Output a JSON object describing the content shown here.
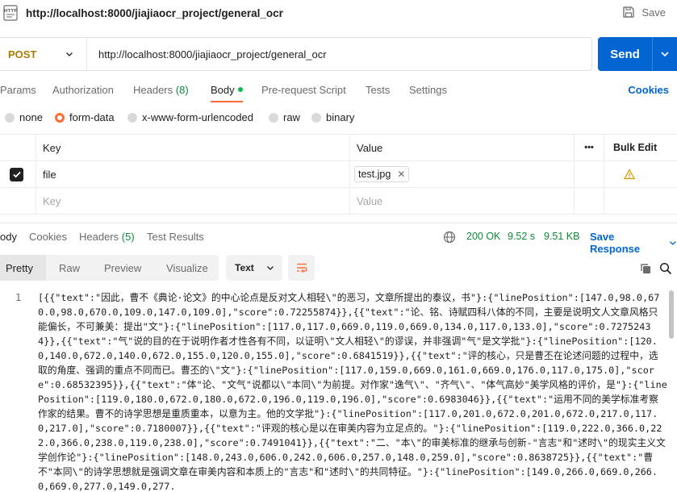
{
  "window": {
    "title": "http://localhost:8000/jiajiaocr_project/general_ocr",
    "save_label": "Save"
  },
  "request": {
    "method": "POST",
    "url": "http://localhost:8000/jiajiaocr_project/general_ocr",
    "send_label": "Send"
  },
  "request_tabs": {
    "params": "Params",
    "authorization": "Authorization",
    "headers": "Headers",
    "headers_count": "(8)",
    "body": "Body",
    "pre_request": "Pre-request Script",
    "tests": "Tests",
    "settings": "Settings",
    "cookies": "Cookies"
  },
  "body_types": {
    "none": "none",
    "form_data": "form-data",
    "urlencoded": "x-www-form-urlencoded",
    "raw": "raw",
    "binary": "binary",
    "selected": "form-data"
  },
  "form_table": {
    "key_header": "Key",
    "value_header": "Value",
    "more_header": "•••",
    "bulk_edit": "Bulk Edit",
    "rows": [
      {
        "checked": true,
        "key": "file",
        "value": "test.jpg"
      }
    ],
    "key_placeholder": "Key",
    "value_placeholder": "Value"
  },
  "response_tabs": {
    "body": "ody",
    "cookies": "Cookies",
    "headers": "Headers",
    "headers_count": "(5)",
    "test_results": "Test Results"
  },
  "response_meta": {
    "status": "200 OK",
    "time": "9.52 s",
    "size": "9.51 KB",
    "save_response": "Save Response"
  },
  "response_view": {
    "pretty": "Pretty",
    "raw": "Raw",
    "preview": "Preview",
    "visualize": "Visualize",
    "format": "Text"
  },
  "code": {
    "line_number": "1",
    "text": "[{{\"text\":\"因此，曹不《典论·论文》的中心论点是反对文人相轻\\\"的恶习，文章所提出的泰议，书\"}:{\"linePosition\":[147.0,98.0,670.0,98.0,670.0,109.0,147.0,109.0],\"score\":0.72255874}},{{\"text\":\"论、铭、诗赋四科八体的不同，主要是说明文人文章风格只能偏长，不可兼美：提出\"文\"}:{\"linePosition\":[117.0,117.0,669.0,119.0,669.0,134.0,117.0,133.0],\"score\":0.72752434}},{{\"text\":\"气\"说的目的在于说明作者才性各有不同，以证明\\\"文人相轻\\\"的谬误，并非强调\"气\"是文学批\"}:{\"linePosition\":[120.0,140.0,672.0,140.0,672.0,155.0,120.0,155.0],\"score\":0.6841519}},{{\"text\":\"评的核心，只是曹丕在论述问题的过程中，选取的角度、强调的重点不同而已。曹丕的\\\"文\"}:{\"linePosition\":[117.0,159.0,669.0,161.0,669.0,176.0,117.0,175.0],\"score\":0.68532395}},{{\"text\":\"体\"论、\"文气\"说都以\\\"本同\\\"为前提。对作家\"逸气\\\"、\"齐气\\\"、\"体气高妙\"美学风格的评价，是\"}:{\"linePosition\":[119.0,180.0,672.0,180.0,672.0,196.0,119.0,196.0],\"score\":0.6983046}},{{\"text\":\"运用不同的美学标准考察作家的结果。曹不的诗学思想是重质重本，以意为主。他的文学批\"}:{\"linePosition\":[117.0,201.0,672.0,201.0,672.0,217.0,117.0,217.0],\"score\":0.7180007}},{{\"text\":\"评观的核心是以在审美内容为立足点的。\"}:{\"linePosition\":[119.0,222.0,366.0,222.0,366.0,238.0,119.0,238.0],\"score\":0.7491041}},{{\"text\":\"二、\"本\\\"的审美标准的继承与创新-\"言志\"和\"述时\\\"的现实主义文学创作论\"}:{\"linePosition\":[148.0,243.0,606.0,242.0,606.0,257.0,148.0,259.0],\"score\":0.8638725}},{{\"text\":\"曹不\"本同\\\"的诗学思想就是强调文章在审美内容和本质上的\"言志\"和\"述时\\\"的共同特征。\"}:{\"linePosition\":[149.0,266.0,669.0,266.0,669.0,277.0,149.0,277."
  }
}
